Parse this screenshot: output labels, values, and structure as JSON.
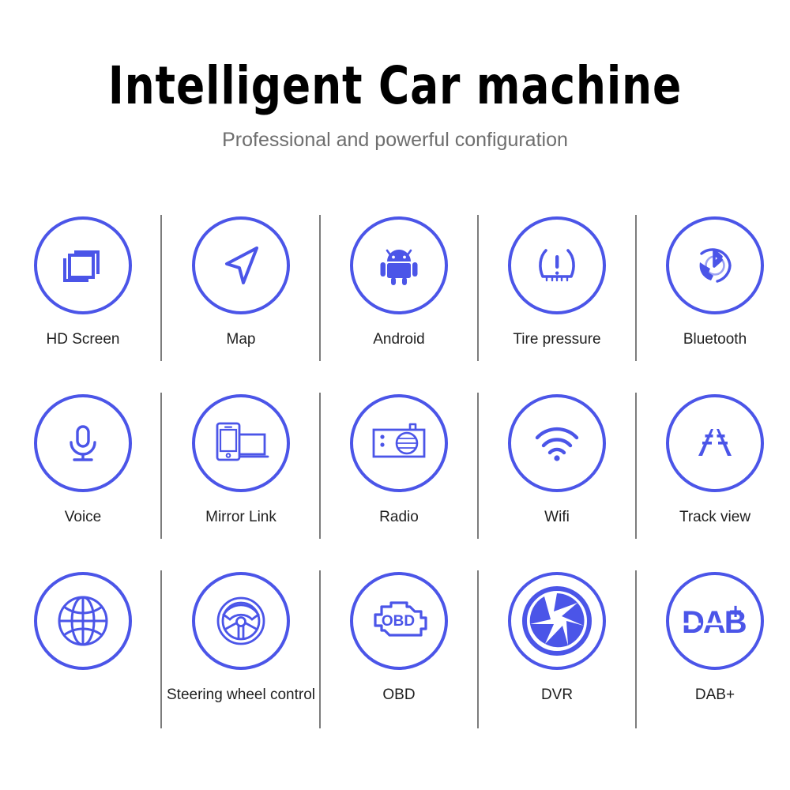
{
  "header": {
    "title": "Intelligent Car machine",
    "subtitle": "Professional and powerful configuration"
  },
  "colors": {
    "accent": "#4B55E8",
    "title": "#000000",
    "subtitle": "#6e6e6e",
    "label": "#1f1f1f",
    "divider": "#7c7c7c",
    "background": "#ffffff"
  },
  "features": {
    "rows": [
      {
        "cells": [
          {
            "label": "HD Screen",
            "icon": "hd-screen-icon"
          },
          {
            "label": "Map",
            "icon": "navigation-arrow-icon"
          },
          {
            "label": "Android",
            "icon": "android-robot-icon"
          },
          {
            "label": "Tire pressure",
            "icon": "tire-pressure-warning-icon"
          },
          {
            "label": "Bluetooth",
            "icon": "bluetooth-phone-icon"
          }
        ]
      },
      {
        "cells": [
          {
            "label": "Voice",
            "icon": "microphone-icon"
          },
          {
            "label": "Mirror Link",
            "icon": "phone-to-screen-icon"
          },
          {
            "label": "Radio",
            "icon": "radio-receiver-icon"
          },
          {
            "label": "Wifi",
            "icon": "wifi-signal-icon"
          },
          {
            "label": "Track view",
            "icon": "road-lane-icon"
          }
        ]
      },
      {
        "cells": [
          {
            "label": "",
            "icon": "globe-icon"
          },
          {
            "label": "Steering wheel control",
            "icon": "steering-wheel-icon"
          },
          {
            "label": "OBD",
            "icon": "obd-engine-icon"
          },
          {
            "label": "DVR",
            "icon": "camera-aperture-icon"
          },
          {
            "label": "DAB+",
            "icon": "dab-plus-logo-icon"
          }
        ]
      }
    ]
  },
  "icon_text": {
    "obd": "OBD",
    "dab": "DAB",
    "dab_plus": "+"
  }
}
